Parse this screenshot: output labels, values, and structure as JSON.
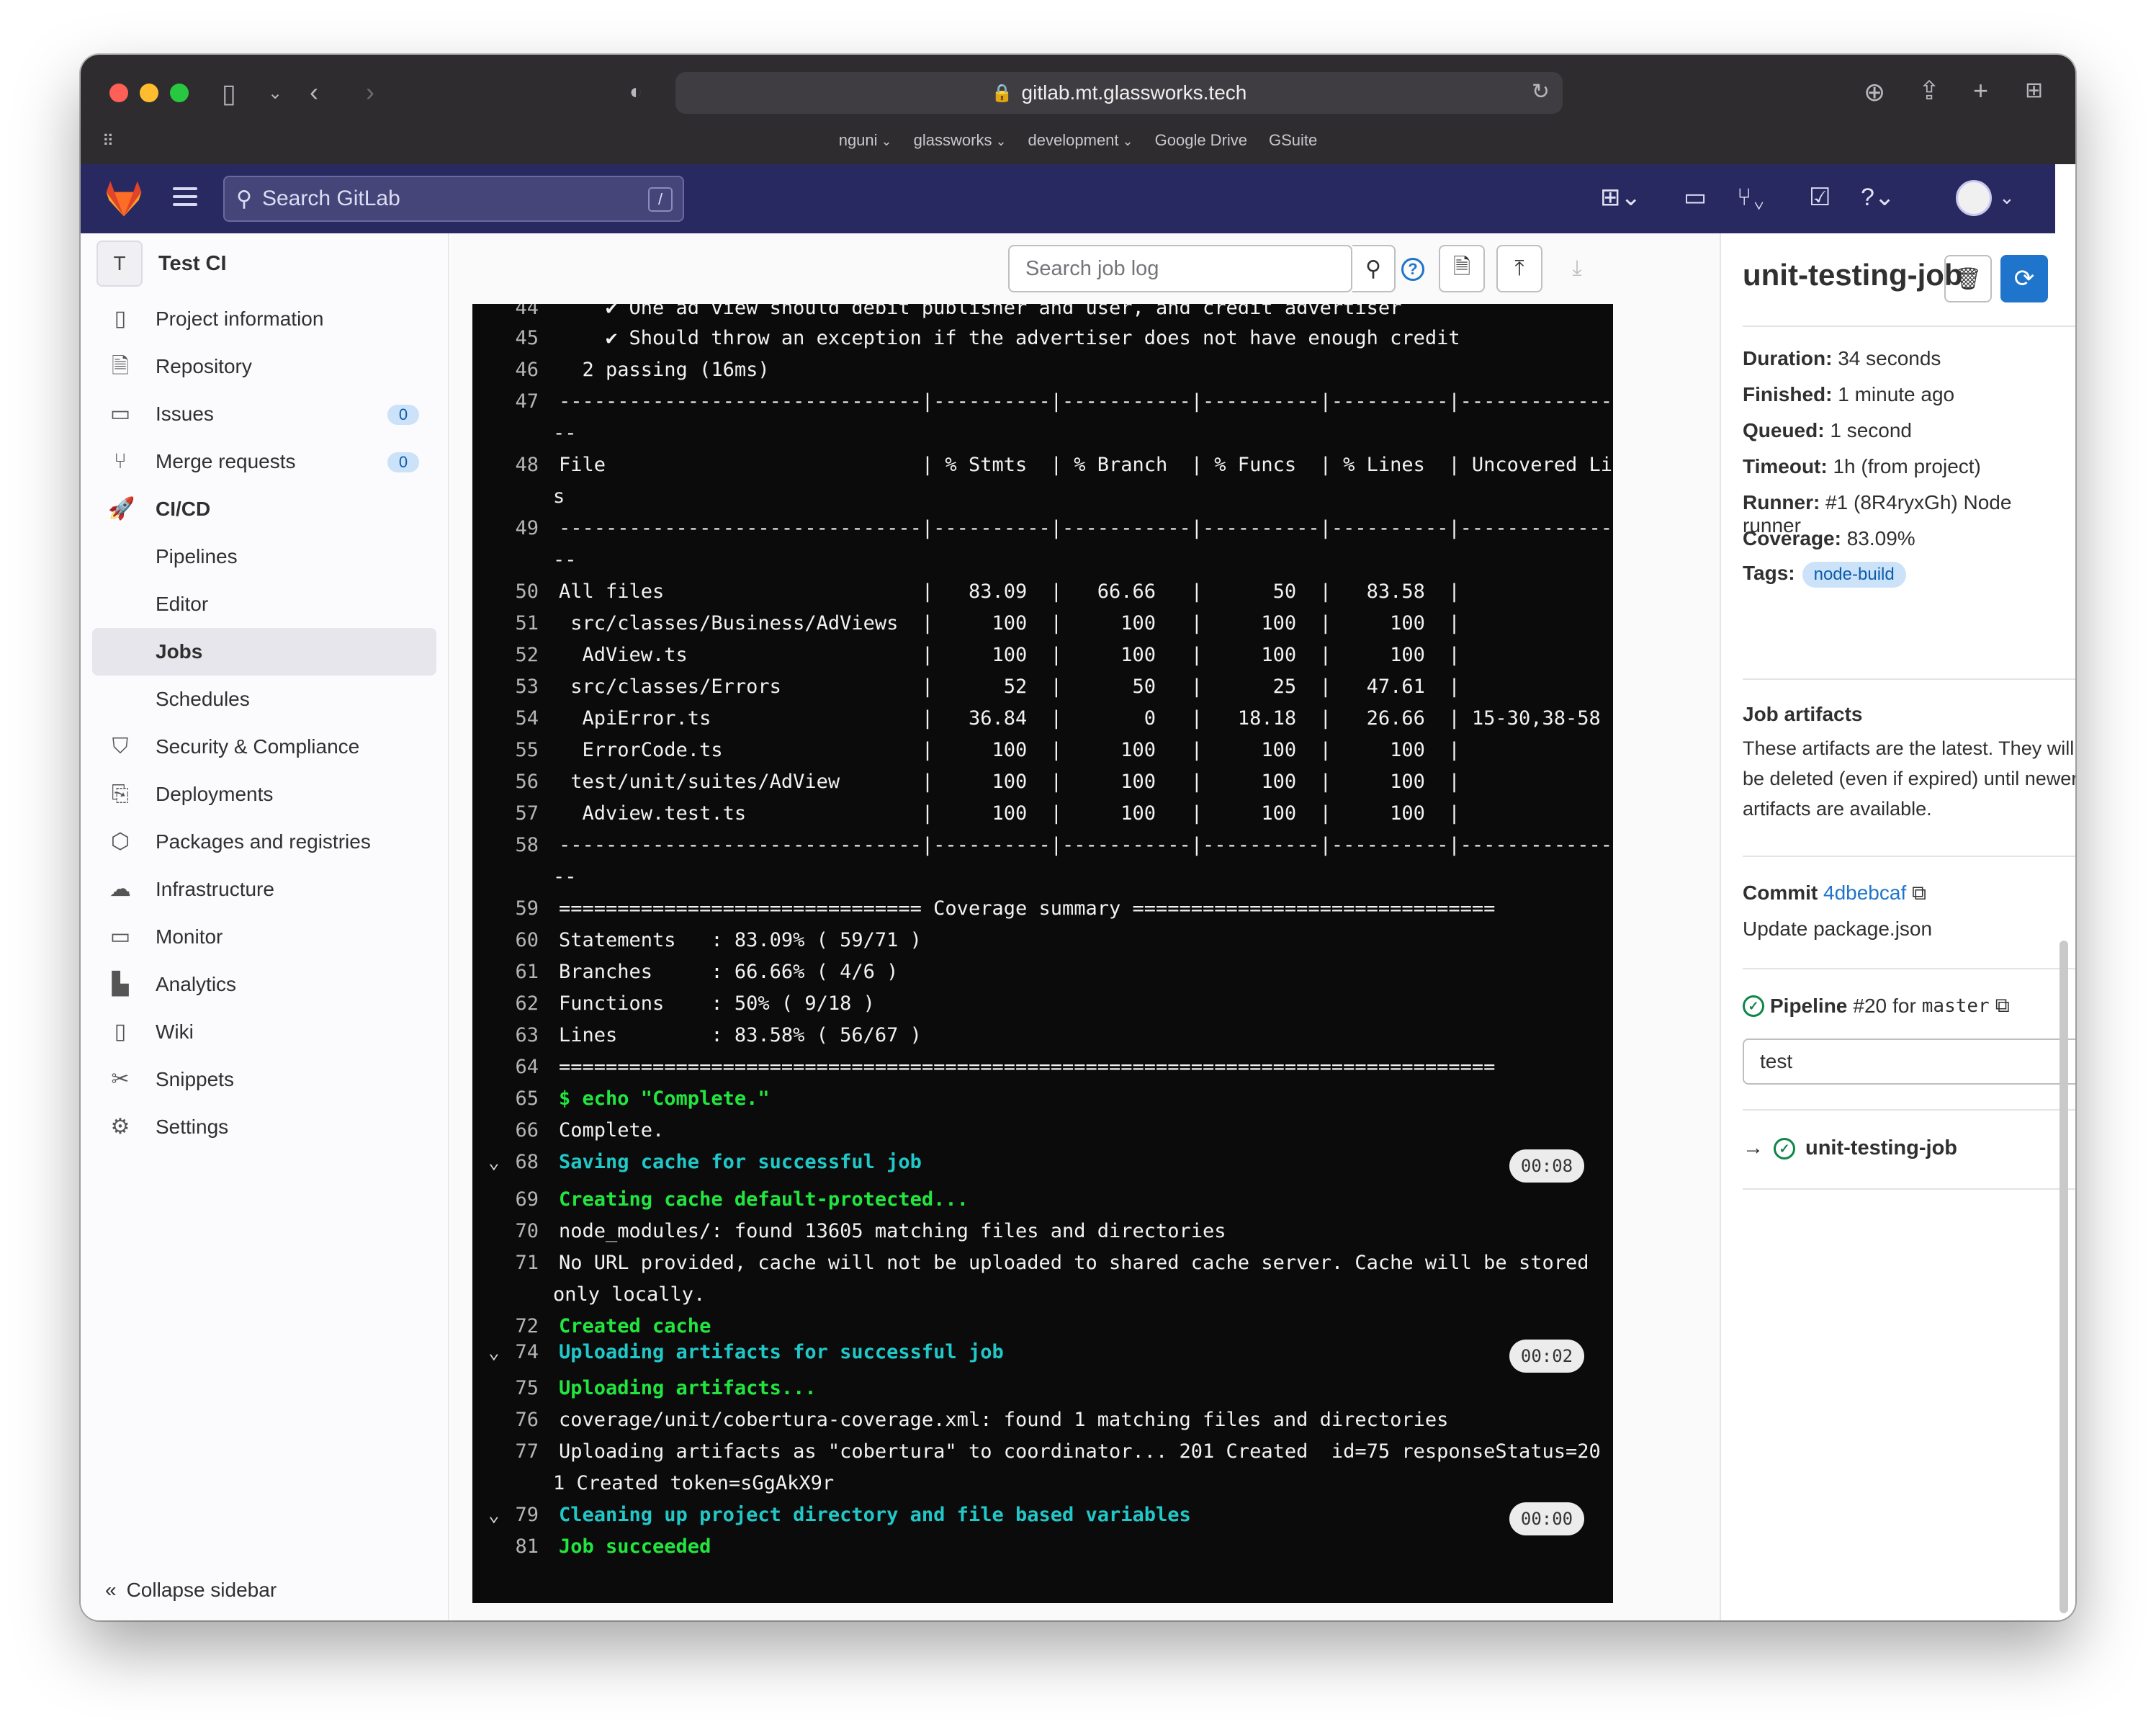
{
  "browser": {
    "url": "gitlab.mt.glassworks.tech",
    "bookmarks": [
      {
        "label": "nguni",
        "dropdown": true
      },
      {
        "label": "glassworks",
        "dropdown": true
      },
      {
        "label": "development",
        "dropdown": true
      },
      {
        "label": "Google Drive",
        "dropdown": false
      },
      {
        "label": "GSuite",
        "dropdown": false
      }
    ]
  },
  "header": {
    "search_placeholder": "Search GitLab",
    "search_shortcut": "/"
  },
  "sidebar": {
    "project_initial": "T",
    "project_name": "Test CI",
    "items": [
      {
        "label": "Project information",
        "icon": "info-icon"
      },
      {
        "label": "Repository",
        "icon": "doc-icon"
      },
      {
        "label": "Issues",
        "icon": "issues-icon",
        "count": "0"
      },
      {
        "label": "Merge requests",
        "icon": "merge-icon",
        "count": "0"
      },
      {
        "label": "CI/CD",
        "icon": "rocket-icon"
      },
      {
        "label": "Pipelines"
      },
      {
        "label": "Editor"
      },
      {
        "label": "Jobs"
      },
      {
        "label": "Schedules"
      },
      {
        "label": "Security & Compliance",
        "icon": "shield-icon"
      },
      {
        "label": "Deployments",
        "icon": "deploy-icon"
      },
      {
        "label": "Packages and registries",
        "icon": "package-icon"
      },
      {
        "label": "Infrastructure",
        "icon": "cloud-icon"
      },
      {
        "label": "Monitor",
        "icon": "monitor-icon"
      },
      {
        "label": "Analytics",
        "icon": "chart-icon"
      },
      {
        "label": "Wiki",
        "icon": "book-icon"
      },
      {
        "label": "Snippets",
        "icon": "scissors-icon"
      },
      {
        "label": "Settings",
        "icon": "gear-icon"
      }
    ],
    "collapse_label": "Collapse sidebar"
  },
  "log": {
    "search_placeholder": "Search job log",
    "lines": [
      {
        "n": "44",
        "text": "    ✔ One ad view should debit publisher and user, and credit advertiser",
        "style": "plain"
      },
      {
        "n": "45",
        "text": "    ✔ Should throw an exception if the advertiser does not have enough credit",
        "style": "plain"
      },
      {
        "n": "46",
        "text": "  2 passing (16ms)",
        "style": "plain"
      },
      {
        "n": "47",
        "text": "-------------------------------|----------|-----------|----------|----------|-------------------",
        "style": "plain"
      },
      {
        "n": "",
        "text": "--",
        "style": "plain"
      },
      {
        "n": "48",
        "text": "File                           | % Stmts  | % Branch  | % Funcs  | % Lines  | Uncovered Line #",
        "style": "plain"
      },
      {
        "n": "",
        "text": "s",
        "style": "plain"
      },
      {
        "n": "49",
        "text": "-------------------------------|----------|-----------|----------|----------|-------------------",
        "style": "plain"
      },
      {
        "n": "",
        "text": "--",
        "style": "plain"
      },
      {
        "n": "50",
        "text": "All files                      |   83.09  |   66.66   |      50  |   83.58  |",
        "style": "plain"
      },
      {
        "n": "51",
        "text": " src/classes/Business/AdViews  |     100  |     100   |     100  |     100  |",
        "style": "plain"
      },
      {
        "n": "52",
        "text": "  AdView.ts                    |     100  |     100   |     100  |     100  |",
        "style": "plain"
      },
      {
        "n": "53",
        "text": " src/classes/Errors            |      52  |      50   |      25  |   47.61  |",
        "style": "plain"
      },
      {
        "n": "54",
        "text": "  ApiError.ts                  |   36.84  |       0   |   18.18  |   26.66  | 15-30,38-58",
        "style": "plain"
      },
      {
        "n": "55",
        "text": "  ErrorCode.ts                 |     100  |     100   |     100  |     100  |",
        "style": "plain"
      },
      {
        "n": "56",
        "text": " test/unit/suites/AdView       |     100  |     100   |     100  |     100  |",
        "style": "plain"
      },
      {
        "n": "57",
        "text": "  Adview.test.ts               |     100  |     100   |     100  |     100  |",
        "style": "plain"
      },
      {
        "n": "58",
        "text": "-------------------------------|----------|-----------|----------|----------|-------------------",
        "style": "plain"
      },
      {
        "n": "",
        "text": "--",
        "style": "plain"
      },
      {
        "n": "59",
        "text": "=============================== Coverage summary ===============================",
        "style": "plain"
      },
      {
        "n": "60",
        "text": "Statements   : 83.09% ( 59/71 )",
        "style": "plain"
      },
      {
        "n": "61",
        "text": "Branches     : 66.66% ( 4/6 )",
        "style": "plain"
      },
      {
        "n": "62",
        "text": "Functions    : 50% ( 9/18 )",
        "style": "plain"
      },
      {
        "n": "63",
        "text": "Lines        : 83.58% ( 56/67 )",
        "style": "plain"
      },
      {
        "n": "64",
        "text": "================================================================================",
        "style": "plain"
      },
      {
        "n": "65",
        "text": "$ echo \"Complete.\"",
        "style": "green"
      },
      {
        "n": "66",
        "text": "Complete.",
        "style": "plain"
      },
      {
        "n": "68",
        "text": "Saving cache for successful job",
        "style": "cyan",
        "section": true,
        "time": "00:08"
      },
      {
        "n": "69",
        "text": "Creating cache default-protected...",
        "style": "green"
      },
      {
        "n": "70",
        "text": "node_modules/: found 13605 matching files and directories",
        "style": "plain"
      },
      {
        "n": "71",
        "text": "No URL provided, cache will not be uploaded to shared cache server. Cache will be stored",
        "style": "plain"
      },
      {
        "n": "",
        "text": "only locally.",
        "style": "plain"
      },
      {
        "n": "72",
        "text": "Created cache",
        "style": "green"
      },
      {
        "n": "74",
        "text": "Uploading artifacts for successful job",
        "style": "cyan",
        "section": true,
        "time": "00:02"
      },
      {
        "n": "75",
        "text": "Uploading artifacts...",
        "style": "green"
      },
      {
        "n": "76",
        "text": "coverage/unit/cobertura-coverage.xml: found 1 matching files and directories",
        "style": "plain"
      },
      {
        "n": "77",
        "text": "Uploading artifacts as \"cobertura\" to coordinator... 201 Created  id=75 responseStatus=20",
        "style": "plain"
      },
      {
        "n": "",
        "text": "1 Created token=sGgAkX9r",
        "style": "plain"
      },
      {
        "n": "79",
        "text": "Cleaning up project directory and file based variables",
        "style": "cyan",
        "section": true,
        "time": "00:00"
      },
      {
        "n": "81",
        "text": "Job succeeded",
        "style": "green"
      }
    ]
  },
  "job": {
    "title": "unit-testing-job",
    "duration_label": "Duration:",
    "duration": "34 seconds",
    "finished_label": "Finished:",
    "finished": "1 minute ago",
    "queued_label": "Queued:",
    "queued": "1 second",
    "timeout_label": "Timeout:",
    "timeout": "1h (from project)",
    "runner_label": "Runner:",
    "runner": "#1 (8R4ryxGh) Node runner",
    "coverage_label": "Coverage:",
    "coverage": "83.09%",
    "tags_label": "Tags:",
    "tag": "node-build",
    "artifacts_title": "Job artifacts",
    "artifacts_text": "These artifacts are the latest. They will not be deleted (even if expired) until newer artifacts are available.",
    "commit_label": "Commit",
    "commit_sha": "4dbebcaf",
    "commit_message": "Update package.json",
    "pipeline_label": "Pipeline",
    "pipeline_id": "#20",
    "pipeline_for": "for",
    "pipeline_ref": "master",
    "stage": "test",
    "job_link": "unit-testing-job"
  },
  "colors": {
    "header_bg": "#292961",
    "accent": "#1f75cb",
    "log_green": "#22e63f",
    "log_cyan": "#21c8c8",
    "success": "#108548"
  }
}
